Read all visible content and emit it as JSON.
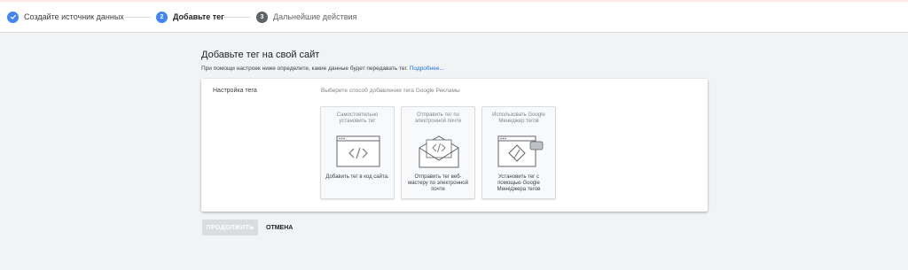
{
  "stepper": {
    "steps": [
      {
        "label": "Создайте источник данных",
        "marker": "check-icon"
      },
      {
        "label": "Добавьте тег",
        "number": "2"
      },
      {
        "label": "Дальнейшие действия",
        "number": "3"
      }
    ]
  },
  "main": {
    "title": "Добавьте тег на свой сайт",
    "description": "При помощи настроек ниже определите, какие данные будет передавать тег.",
    "learn_more": "Подробнее..."
  },
  "card": {
    "label": "Настройка тега",
    "instruction": "Выберите способ добавления тега Google Рекламы",
    "options": [
      {
        "title": "Самостоятельно установить тег",
        "caption": "Добавить тег в код сайта.",
        "icon": "code-browser-icon"
      },
      {
        "title": "Отправить тег по электронной почте",
        "caption": "Отправить тег веб-мастеру по электронной почте",
        "icon": "email-code-icon"
      },
      {
        "title": "Использовать Google Менеджер тегов",
        "caption": "Установить тег с помощью Google Менеджера тегов",
        "icon": "tag-manager-icon"
      }
    ]
  },
  "actions": {
    "continue_label": "ПРОДОЛЖИТЬ",
    "cancel_label": "ОТМЕНА"
  },
  "colors": {
    "accent": "#4285f4",
    "inactive_step": "#5f6368",
    "link": "#1a73e8",
    "background": "#f1f3f4"
  }
}
